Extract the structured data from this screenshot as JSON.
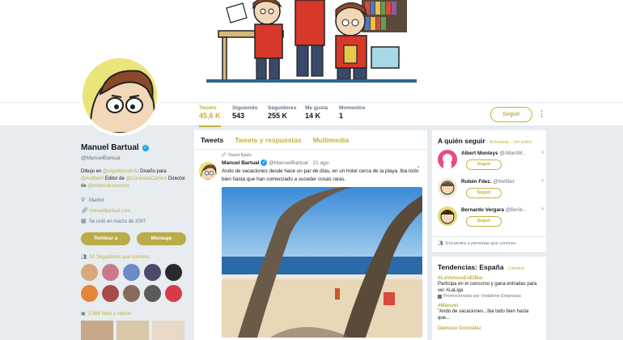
{
  "stats": [
    {
      "label": "Tweets",
      "value": "45,6 K"
    },
    {
      "label": "Siguiendo",
      "value": "543"
    },
    {
      "label": "Seguidores",
      "value": "255 K"
    },
    {
      "label": "Me gusta",
      "value": "14 K"
    },
    {
      "label": "Momentos",
      "value": "1"
    }
  ],
  "follow_button": "Seguir",
  "more_icon": "more-vertical-icon",
  "profile": {
    "name": "Manuel Bartual",
    "handle": "@ManuelBartual",
    "bio_1": "Dibujo en ",
    "bio_link1": "@orgulloysatisfa",
    "bio_2": " Diseño para ",
    "bio_link2": "@Astiberri",
    "bio_3": " Editor de ",
    "bio_link3": "@CarambaComics",
    "bio_4": " Director de ",
    "bio_link4": "@todosutesecretos",
    "location": "Madrid",
    "website": "manuelbartual.com",
    "joined": "Se unió en marzo de 2007",
    "tweet_to": "Twittear a",
    "message": "Mensaje",
    "followers_you_know": "52 Seguidores que conoces",
    "photos_videos": "3.986 fotos y videos"
  },
  "tabs": [
    "Tweets",
    "Tweets y respuestas",
    "Multimedia"
  ],
  "tweet": {
    "pinned": "Tweet fijado",
    "name": "Manuel Bartual",
    "handle_time": "@ManuelBartual · 21 ago.",
    "text": "Ando de vacaciones desde hace un par de días, en un hotel cerca de la playa. Iba todo bien hasta que han comenzado a suceder cosas raras."
  },
  "who_to_follow": {
    "title": "A quién seguir",
    "sub_prefix": " · ",
    "refresh": "Actualizar",
    "view_all": "Ver todos",
    "suggestions": [
      {
        "name": "Albert Monteys",
        "handle": "@AlbertM...",
        "button": "Seguir"
      },
      {
        "name": "Rubén Fdez.",
        "handle": "@thefdez",
        "button": "Seguir"
      },
      {
        "name": "Bernardo Vergara",
        "handle": "@BeVe...",
        "button": "Seguir"
      }
    ],
    "footer": "Encuentra a personas que conoces"
  },
  "trends": {
    "title": "Tendencias: España",
    "change": " · Cambiar",
    "items": [
      {
        "tag": "#LoVemosEnElBar",
        "desc": "Participa en el concurso y gana entradas para ver #LaLiga",
        "promo": "Promocionado por Vodafone Empresas"
      },
      {
        "tag": "#Manuel",
        "desc": "\"Ando de vacaciones...Iba todo bien hasta que...",
        "promo": ""
      },
      {
        "tag": "Dámaso González",
        "desc": "",
        "promo": ""
      }
    ]
  },
  "colors": {
    "accent": "#c1b23c",
    "button_fill": "#b9ac49",
    "link_blue": "#1da1f2",
    "bg": "#e6ecf0"
  }
}
